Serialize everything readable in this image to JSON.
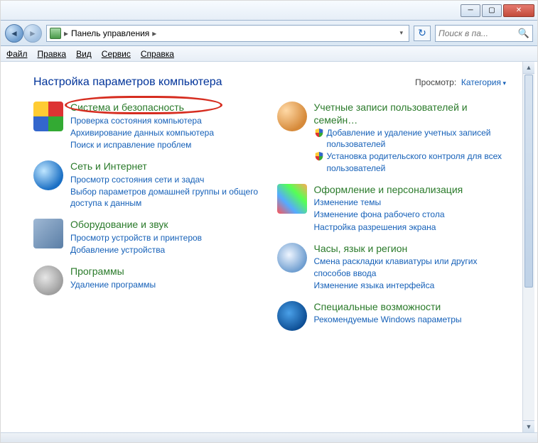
{
  "address": {
    "location": "Панель управления",
    "arrow": "▸"
  },
  "search": {
    "placeholder": "Поиск в па..."
  },
  "menu": {
    "file": "Файл",
    "edit": "Правка",
    "view": "Вид",
    "tools": "Сервис",
    "help": "Справка"
  },
  "heading": "Настройка параметров компьютера",
  "viewby": {
    "label": "Просмотр:",
    "value": "Категория"
  },
  "left": [
    {
      "icon": "ic-shield",
      "title": "Система и безопасность",
      "links": [
        "Проверка состояния компьютера",
        "Архивирование данных компьютера",
        "Поиск и исправление проблем"
      ]
    },
    {
      "icon": "ic-net",
      "title": "Сеть и Интернет",
      "links": [
        "Просмотр состояния сети и задач",
        "Выбор параметров домашней группы и общего доступа к данным"
      ]
    },
    {
      "icon": "ic-hw",
      "title": "Оборудование и звук",
      "links": [
        "Просмотр устройств и принтеров",
        "Добавление устройства"
      ]
    },
    {
      "icon": "ic-prog",
      "title": "Программы",
      "links": [
        "Удаление программы"
      ]
    }
  ],
  "right": [
    {
      "icon": "ic-users",
      "title": "Учетные записи пользователей и семейн…",
      "shielded": [
        "Добавление и удаление учетных записей пользователей",
        "Установка родительского контроля для всех пользователей"
      ]
    },
    {
      "icon": "ic-pers",
      "title": "Оформление и персонализация",
      "links": [
        "Изменение темы",
        "Изменение фона рабочего стола",
        "Настройка разрешения экрана"
      ]
    },
    {
      "icon": "ic-clock",
      "title": "Часы, язык и регион",
      "links": [
        "Смена раскладки клавиатуры или других способов ввода",
        "Изменение языка интерфейса"
      ]
    },
    {
      "icon": "ic-ease",
      "title": "Специальные возможности",
      "links": [
        "Рекомендуемые Windows параметры"
      ]
    }
  ]
}
